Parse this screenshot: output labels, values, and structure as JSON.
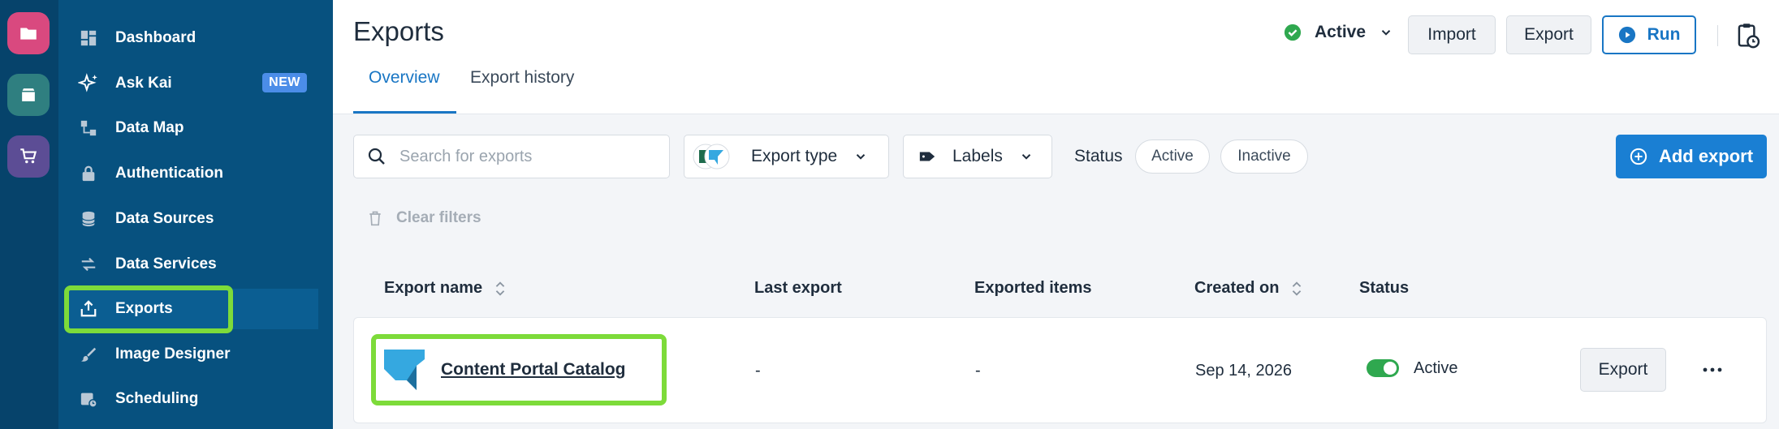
{
  "sidebar": {
    "items": [
      {
        "label": "Dashboard",
        "icon": "dashboard-icon"
      },
      {
        "label": "Ask Kai",
        "icon": "sparkle-icon",
        "badge": "NEW"
      },
      {
        "label": "Data Map",
        "icon": "data-map-icon"
      },
      {
        "label": "Authentication",
        "icon": "lock-icon"
      },
      {
        "label": "Data Sources",
        "icon": "database-icon"
      },
      {
        "label": "Data Services",
        "icon": "swap-icon"
      },
      {
        "label": "Exports",
        "icon": "export-icon"
      },
      {
        "label": "Image Designer",
        "icon": "brush-icon"
      },
      {
        "label": "Scheduling",
        "icon": "calendar-clock-icon"
      }
    ]
  },
  "header": {
    "title": "Exports",
    "tabs": [
      {
        "label": "Overview"
      },
      {
        "label": "Export history"
      }
    ],
    "status": "Active",
    "import_label": "Import",
    "export_label": "Export",
    "run_label": "Run"
  },
  "filters": {
    "search_placeholder": "Search for exports",
    "export_type_label": "Export type",
    "labels_label": "Labels",
    "status_label": "Status",
    "status_active": "Active",
    "status_inactive": "Inactive",
    "clear_label": "Clear filters",
    "add_label": "Add export"
  },
  "table": {
    "columns": [
      "Export name",
      "Last export",
      "Exported items",
      "Created on",
      "Status"
    ],
    "rows": [
      {
        "name": "Content Portal Catalog",
        "last_export": "-",
        "exported_items": "-",
        "created_on": "Sep 14, 2026",
        "status": "Active",
        "action_label": "Export"
      }
    ]
  },
  "colors": {
    "sidebar": "#07517f",
    "rail": "#06436b",
    "accent": "#1976c4",
    "highlight": "#7ddb3a",
    "success": "#2fa84f"
  }
}
